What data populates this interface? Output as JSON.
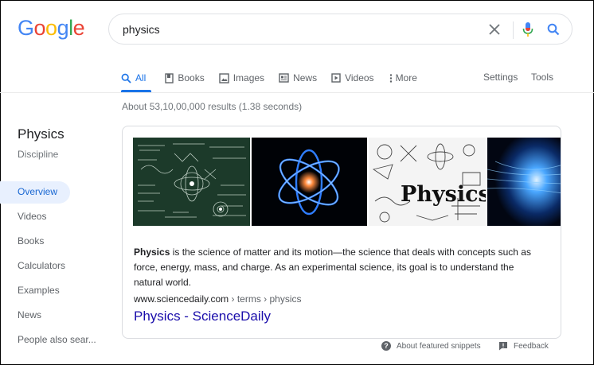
{
  "logo": {
    "letters": [
      {
        "ch": "G",
        "color": "#4285f4"
      },
      {
        "ch": "o",
        "color": "#ea4335"
      },
      {
        "ch": "o",
        "color": "#fbbc05"
      },
      {
        "ch": "g",
        "color": "#4285f4"
      },
      {
        "ch": "l",
        "color": "#34a853"
      },
      {
        "ch": "e",
        "color": "#ea4335"
      }
    ]
  },
  "search": {
    "query": "physics"
  },
  "tabs": [
    {
      "label": "All",
      "icon": "search-icon",
      "active": true
    },
    {
      "label": "Books",
      "icon": "book-icon"
    },
    {
      "label": "Images",
      "icon": "image-icon"
    },
    {
      "label": "News",
      "icon": "news-icon"
    },
    {
      "label": "Videos",
      "icon": "video-icon"
    },
    {
      "label": "More",
      "icon": "more-vert-icon"
    }
  ],
  "tools": {
    "settings": "Settings",
    "tools": "Tools"
  },
  "result_stats": "About 53,10,00,000 results (1.38 seconds)",
  "knowledge_panel": {
    "title": "Physics",
    "subtitle": "Discipline",
    "nav": [
      "Overview",
      "Videos",
      "Books",
      "Calculators",
      "Examples",
      "News",
      "People also sear..."
    ]
  },
  "featured_snippet": {
    "bold_term": "Physics",
    "text": " is the science of matter and its motion—the science that deals with concepts such as force, energy, mass, and charge. As an experimental science, its goal is to understand the natural world.",
    "cite_domain": "www.sciencedaily.com",
    "cite_path": " › terms › physics",
    "link_title": "Physics - ScienceDaily",
    "image_word": "Physics"
  },
  "footer": {
    "about": "About featured snippets",
    "feedback": "Feedback"
  },
  "colors": {
    "accent": "#1a73e8",
    "link": "#1a0dab",
    "mic_blue": "#4285f4",
    "mic_red": "#ea4335"
  }
}
